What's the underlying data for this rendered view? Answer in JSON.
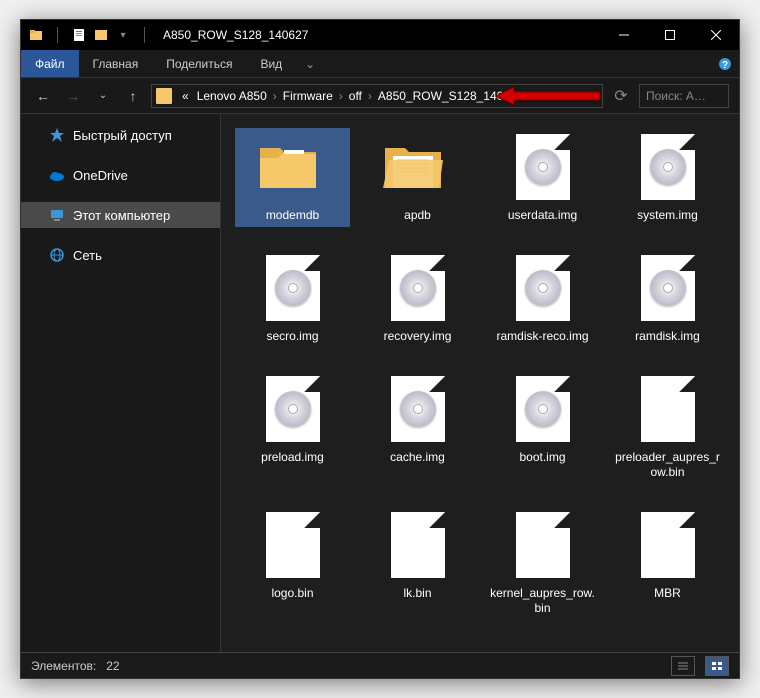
{
  "window_title": "A850_ROW_S128_140627",
  "ribbon": {
    "file": "Файл",
    "home": "Главная",
    "share": "Поделиться",
    "view": "Вид"
  },
  "breadcrumb": {
    "pre": "«",
    "parts": [
      "Lenovo A850",
      "Firmware",
      "off",
      "A850_ROW_S128_140627"
    ]
  },
  "search_placeholder": "Поиск: A…",
  "sidebar": {
    "quick": "Быстрый доступ",
    "onedrive": "OneDrive",
    "thispc": "Этот компьютер",
    "network": "Сеть"
  },
  "files": [
    {
      "name": "modemdb",
      "type": "folder",
      "selected": true
    },
    {
      "name": "apdb",
      "type": "folder-open"
    },
    {
      "name": "userdata.img",
      "type": "img"
    },
    {
      "name": "system.img",
      "type": "img"
    },
    {
      "name": "secro.img",
      "type": "img"
    },
    {
      "name": "recovery.img",
      "type": "img"
    },
    {
      "name": "ramdisk-reco.img",
      "type": "img"
    },
    {
      "name": "ramdisk.img",
      "type": "img"
    },
    {
      "name": "preload.img",
      "type": "img"
    },
    {
      "name": "cache.img",
      "type": "img"
    },
    {
      "name": "boot.img",
      "type": "img"
    },
    {
      "name": "preloader_aupres_row.bin",
      "type": "blank"
    },
    {
      "name": "logo.bin",
      "type": "blank"
    },
    {
      "name": "lk.bin",
      "type": "blank"
    },
    {
      "name": "kernel_aupres_row.bin",
      "type": "blank"
    },
    {
      "name": "MBR",
      "type": "blank"
    }
  ],
  "status": {
    "label": "Элементов:",
    "count": "22"
  }
}
